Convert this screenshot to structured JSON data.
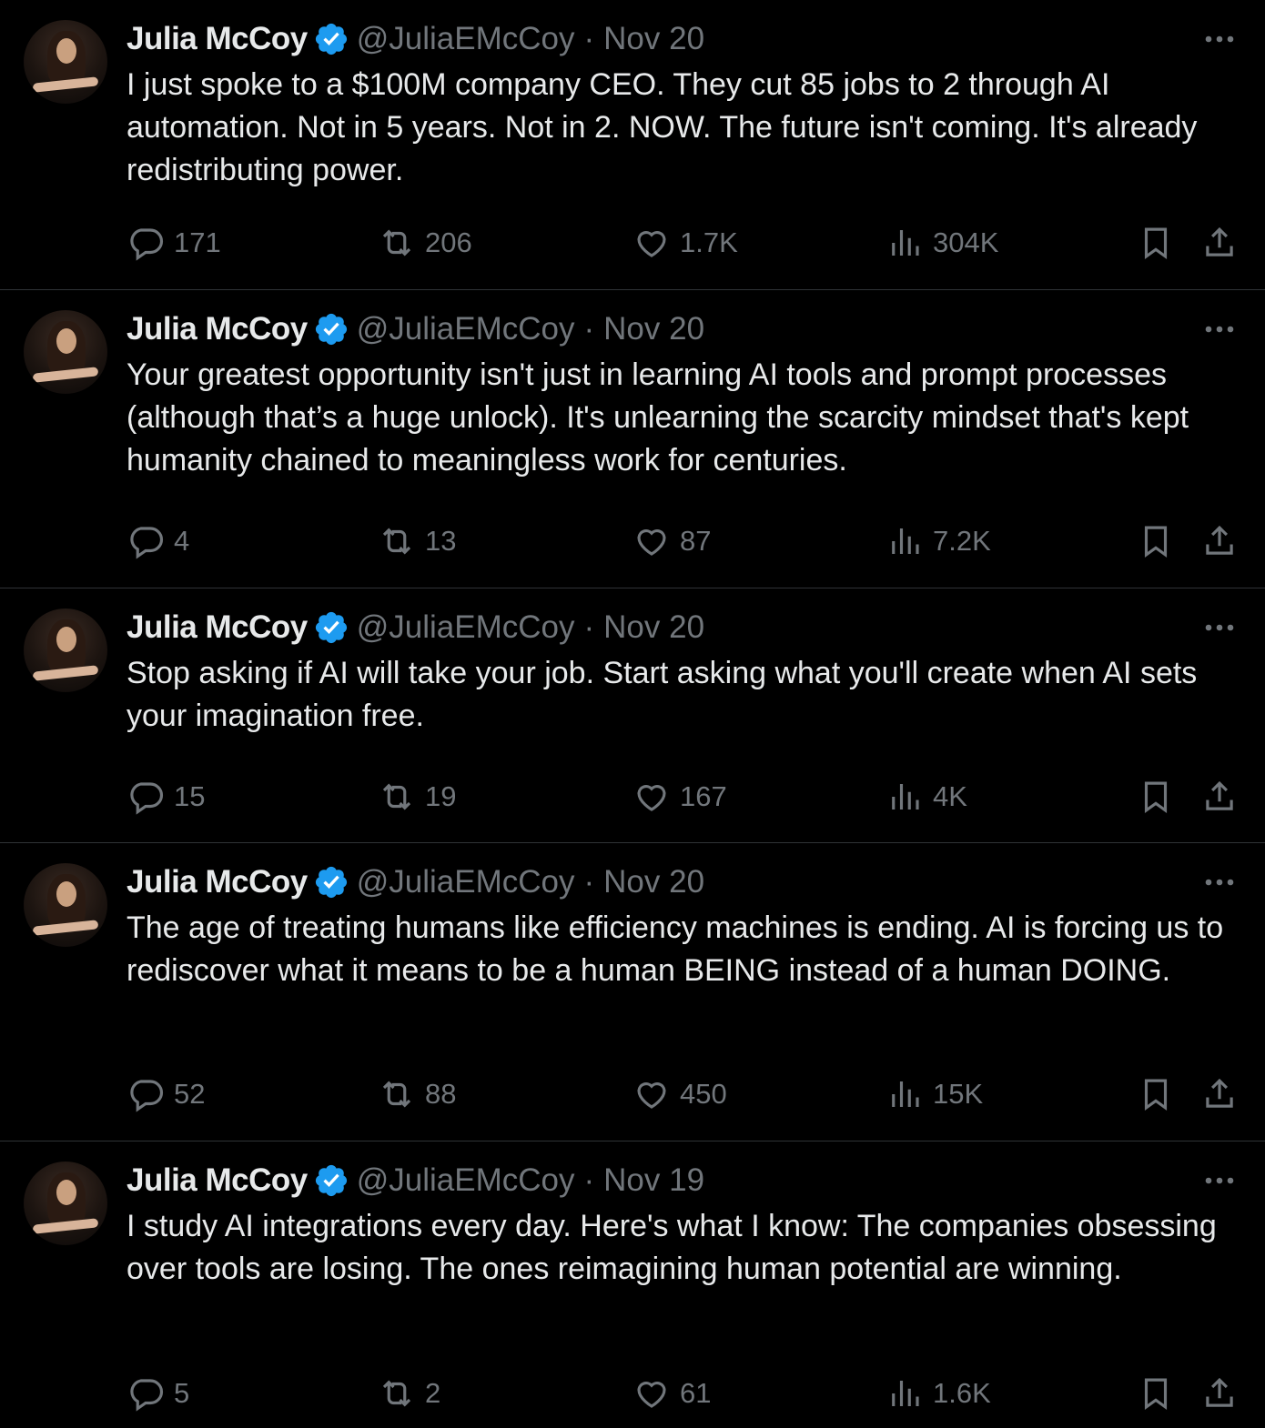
{
  "tweets": [
    {
      "name": "Julia McCoy",
      "handle": "@JuliaEMcCoy",
      "separator": "·",
      "date": "Nov 20",
      "text": "I just spoke to a $100M company CEO. They cut 85 jobs to 2 through AI automation. Not in 5 years. Not in 2. NOW. The future isn't coming. It's already redistributing power.",
      "replies": "171",
      "reposts": "206",
      "likes": "1.7K",
      "views": "304K"
    },
    {
      "name": "Julia McCoy",
      "handle": "@JuliaEMcCoy",
      "separator": "·",
      "date": "Nov 20",
      "text": "Your greatest opportunity isn't just in learning AI tools and prompt processes (although that’s a huge unlock). It's unlearning the scarcity mindset that's kept humanity chained to meaningless work for centuries.",
      "replies": "4",
      "reposts": "13",
      "likes": "87",
      "views": "7.2K"
    },
    {
      "name": "Julia McCoy",
      "handle": "@JuliaEMcCoy",
      "separator": "·",
      "date": "Nov 20",
      "text": "Stop asking if AI will take your job. Start asking what you'll create when AI sets your imagination free.",
      "replies": "15",
      "reposts": "19",
      "likes": "167",
      "views": "4K"
    },
    {
      "name": "Julia McCoy",
      "handle": "@JuliaEMcCoy",
      "separator": "·",
      "date": "Nov 20",
      "text": "The age of treating humans like efficiency machines is ending. AI is forcing us to rediscover what it means to be a human BEING instead of a human DOING.",
      "replies": "52",
      "reposts": "88",
      "likes": "450",
      "views": "15K"
    },
    {
      "name": "Julia McCoy",
      "handle": "@JuliaEMcCoy",
      "separator": "·",
      "date": "Nov 19",
      "text": "I study AI integrations every day. Here's what I know: The companies obsessing over tools are losing. The ones reimagining human potential are winning.",
      "replies": "5",
      "reposts": "2",
      "likes": "61",
      "views": "1.6K"
    }
  ],
  "icons": {
    "avatar": "avatar-photo",
    "verified": "verified-badge-icon",
    "more": "more-icon",
    "reply": "reply-icon",
    "repost": "repost-icon",
    "like": "like-icon",
    "views": "views-icon",
    "bookmark": "bookmark-icon",
    "share": "share-icon"
  },
  "colors": {
    "background": "#000000",
    "text": "#e7e9ea",
    "secondary": "#71767b",
    "verified": "#1d9bf0",
    "divider": "#2f3336"
  }
}
